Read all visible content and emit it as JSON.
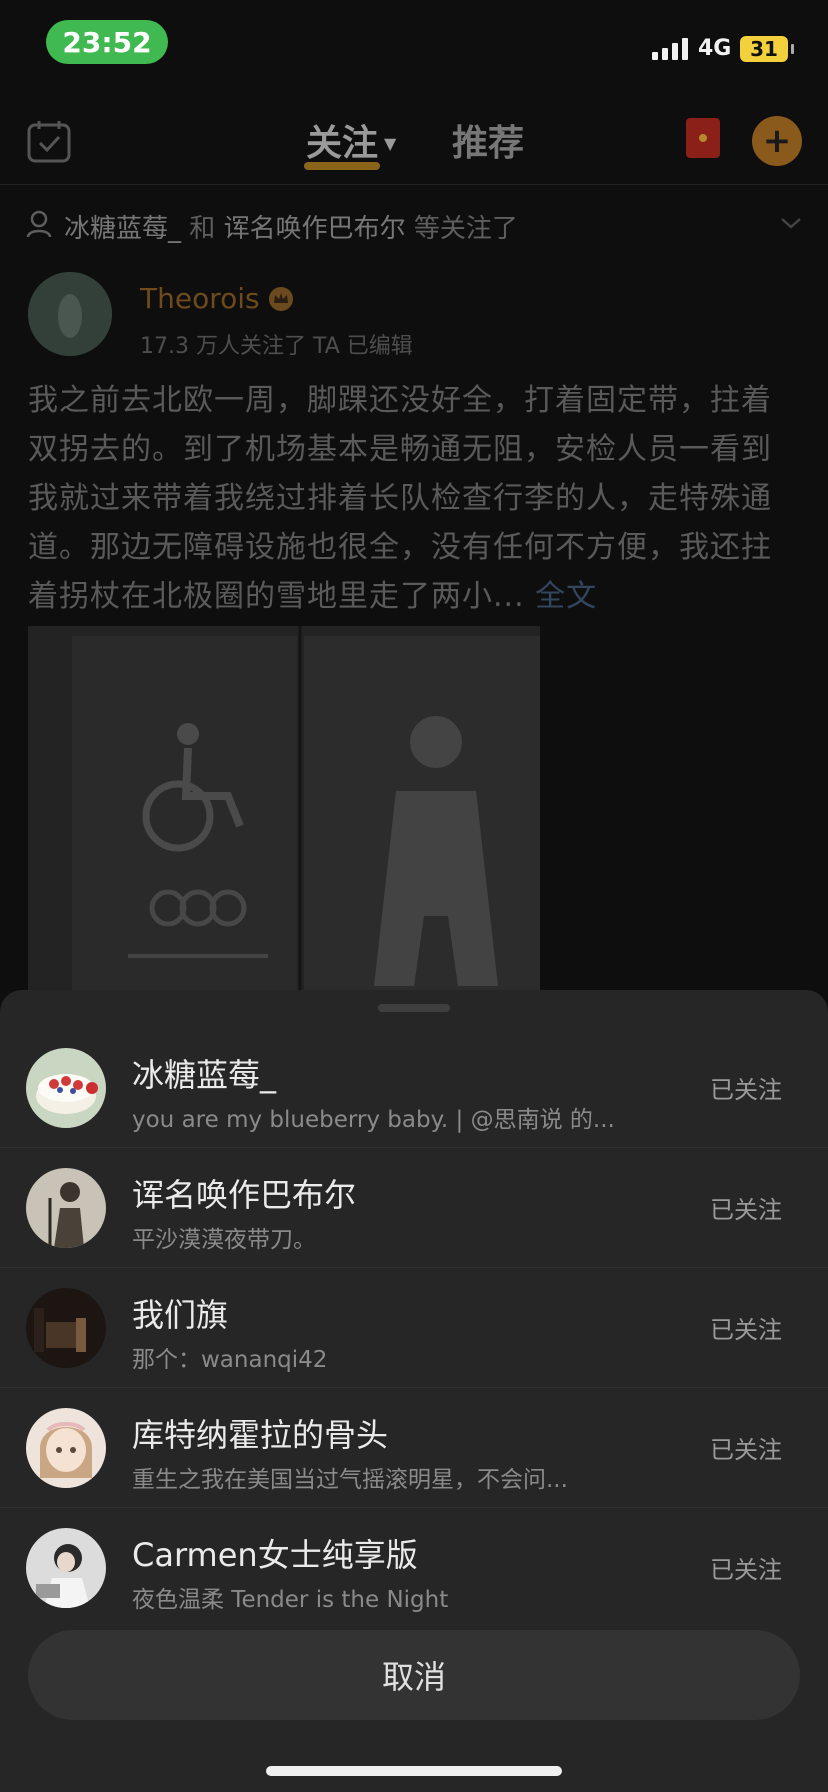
{
  "status_bar": {
    "time": "23:52",
    "network": "4G",
    "battery": "31"
  },
  "nav": {
    "tab_follow": "关注",
    "tab_recommend": "推荐"
  },
  "followed_banner": {
    "user1": "冰糖蓝莓_",
    "conj": "和",
    "user2": "诨名唤作巴布尔",
    "suffix": "等关注了"
  },
  "post": {
    "author": "Theorois",
    "meta": "17.3 万人关注了 TA  已编辑",
    "text": "我之前去北欧一周，脚踝还没好全，打着固定带，拄着双拐去的。到了机场基本是畅通无阻，安检人员一看到我就过来带着我绕过排着长队检查行李的人，走特殊通道。那边无障碍设施也很全，没有任何不方便，我还拄着拐杖在北极圈的雪地里走了两小...",
    "more": "全文"
  },
  "sheet": {
    "users": [
      {
        "name": "冰糖蓝莓_",
        "bio": "you are my blueberry baby.  | @思南说 的...",
        "status": "已关注"
      },
      {
        "name": "诨名唤作巴布尔",
        "bio": "平沙漠漠夜带刀。",
        "status": "已关注"
      },
      {
        "name": "我们旗",
        "bio": "那个：wananqi42",
        "status": "已关注"
      },
      {
        "name": "库特纳霍拉的骨头",
        "bio": "重生之我在美国当过气摇滚明星，不会问...",
        "status": "已关注"
      },
      {
        "name": "Carmen女士纯享版",
        "bio": "夜色温柔 Tender is the Night",
        "status": "已关注"
      }
    ],
    "cancel": "取消"
  }
}
